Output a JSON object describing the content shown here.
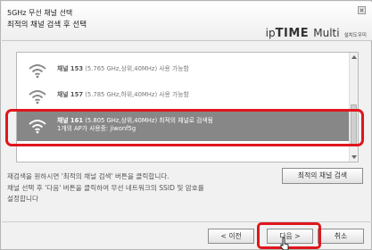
{
  "header": {
    "title": "5GHz 무선 채널 선택",
    "subtitle": "최적의 채널 검색 후 선택",
    "brand_ip": "ip",
    "brand_time": "TIME",
    "brand_multi": "Multi",
    "brand_sub": "설치도우미"
  },
  "channels": [
    {
      "name": "채널 153",
      "detail": "(5.765 GHz,상위,40MHz) 사용 가능함",
      "detail2": ""
    },
    {
      "name": "채널 157",
      "detail": "(5.785 GHz,하위,40MHz) 사용 가능함",
      "detail2": ""
    },
    {
      "name": "채널 161",
      "detail": "(5.805 GHz,상위,40MHz) 최적의 채널로 검색됨",
      "detail2": "1개의 AP가 사용중: jiwonf5g"
    }
  ],
  "instructions": {
    "line1": "재검색을 원하시면 '최적의 채널 검색' 버튼을 클릭합니다.",
    "line2": "채널 선택 후 '다음' 버튼을 클릭하여 무선 네트워크의 SSID 및 암호를",
    "line3": "설정합니다"
  },
  "buttons": {
    "search": "최적의 채널 검색",
    "prev": "< 이전",
    "next": "다음 >",
    "cancel": "취소"
  },
  "colors": {
    "highlight": "#e0161d",
    "selected_row": "#878787"
  },
  "selected_channel": "채널 161"
}
